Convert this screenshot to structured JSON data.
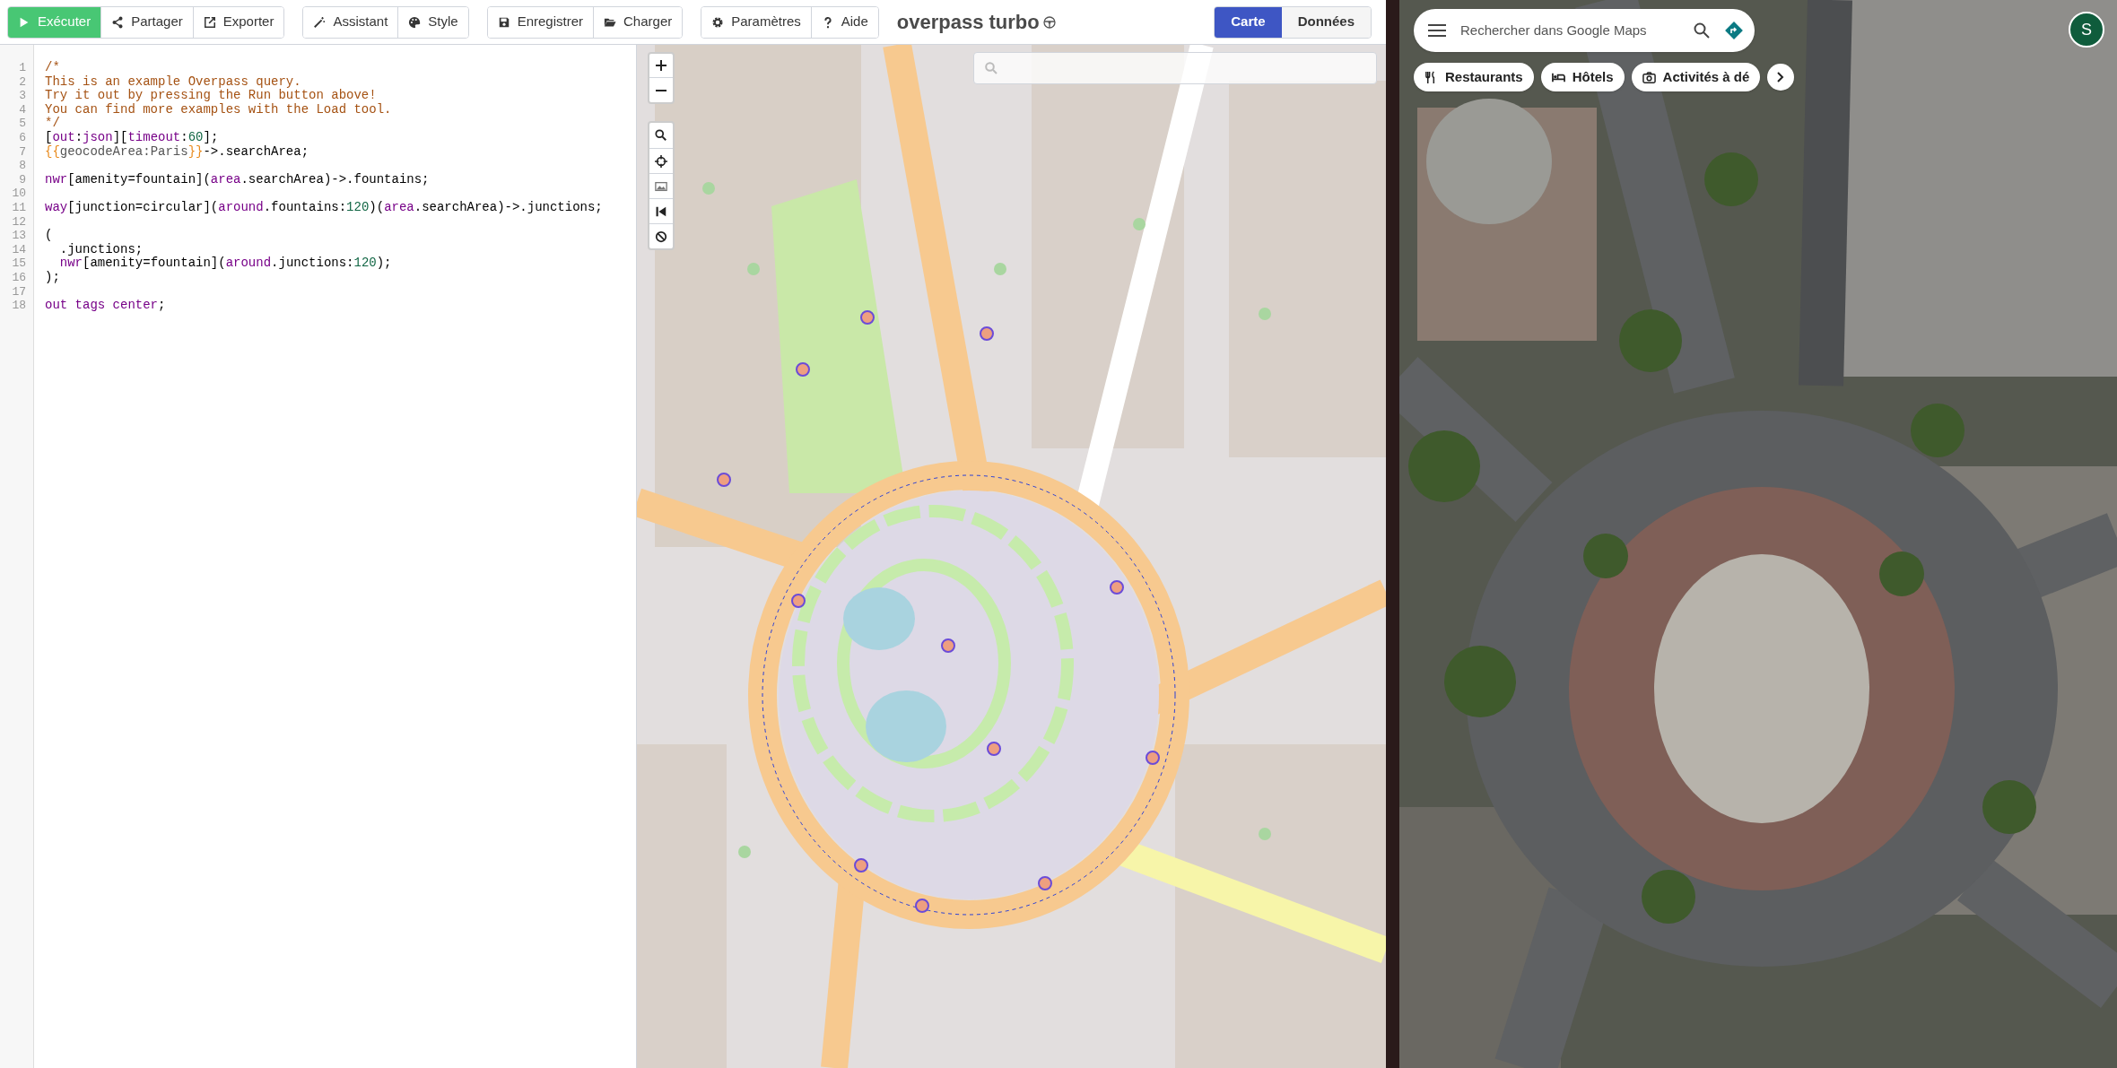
{
  "toolbar": {
    "groups": [
      [
        {
          "label": "Exécuter",
          "kind": "run"
        },
        {
          "label": "Partager",
          "kind": "normal"
        },
        {
          "label": "Exporter",
          "kind": "normal"
        }
      ],
      [
        {
          "label": "Assistant",
          "kind": "normal"
        },
        {
          "label": "Style",
          "kind": "normal"
        }
      ],
      [
        {
          "label": "Enregistrer",
          "kind": "normal"
        },
        {
          "label": "Charger",
          "kind": "normal"
        }
      ],
      [
        {
          "label": "Paramètres",
          "kind": "normal"
        },
        {
          "label": "Aide",
          "kind": "normal"
        }
      ]
    ],
    "app_title": "overpass turbo",
    "view_tabs": [
      {
        "label": "Carte",
        "selected": true
      },
      {
        "label": "Données",
        "selected": false
      }
    ]
  },
  "editor": {
    "lines": [
      {
        "number": "1",
        "tokens": [
          {
            "kind": "comment",
            "text": "/*"
          }
        ]
      },
      {
        "number": "2",
        "tokens": [
          {
            "kind": "comment",
            "text": "This is an example Overpass query."
          }
        ]
      },
      {
        "number": "3",
        "tokens": [
          {
            "kind": "comment",
            "text": "Try it out by pressing the Run button above!"
          }
        ]
      },
      {
        "number": "4",
        "tokens": [
          {
            "kind": "comment",
            "text": "You can find more examples with the Load tool."
          }
        ]
      },
      {
        "number": "5",
        "tokens": [
          {
            "kind": "comment",
            "text": "*/"
          }
        ]
      },
      {
        "number": "6",
        "tokens": [
          {
            "kind": "plain",
            "text": "["
          },
          {
            "kind": "keyword",
            "text": "out"
          },
          {
            "kind": "plain",
            "text": ":"
          },
          {
            "kind": "keyword",
            "text": "json"
          },
          {
            "kind": "plain",
            "text": "]["
          },
          {
            "kind": "keyword",
            "text": "timeout"
          },
          {
            "kind": "plain",
            "text": ":"
          },
          {
            "kind": "number",
            "text": "60"
          },
          {
            "kind": "plain",
            "text": "];"
          }
        ]
      },
      {
        "number": "7",
        "tokens": [
          {
            "kind": "template",
            "text": "{{"
          },
          {
            "kind": "template_body",
            "text": "geocodeArea:Paris"
          },
          {
            "kind": "template",
            "text": "}}"
          },
          {
            "kind": "plain",
            "text": "->.searchArea;"
          }
        ]
      },
      {
        "number": "8"
      },
      {
        "number": "9",
        "tokens": [
          {
            "kind": "keyword",
            "text": "nwr"
          },
          {
            "kind": "plain",
            "text": "[amenity=fountain]("
          },
          {
            "kind": "keyword",
            "text": "area"
          },
          {
            "kind": "plain",
            "text": ".searchArea)->.fountains;"
          }
        ]
      },
      {
        "number": "10"
      },
      {
        "number": "11",
        "tokens": [
          {
            "kind": "keyword",
            "text": "way"
          },
          {
            "kind": "plain",
            "text": "[junction=circular]("
          },
          {
            "kind": "keyword",
            "text": "around"
          },
          {
            "kind": "plain",
            "text": ".fountains:"
          },
          {
            "kind": "number",
            "text": "120"
          },
          {
            "kind": "plain",
            "text": ")("
          },
          {
            "kind": "keyword",
            "text": "area"
          },
          {
            "kind": "plain",
            "text": ".searchArea)->.junctions;"
          }
        ]
      },
      {
        "number": "12"
      },
      {
        "number": "13",
        "tokens": [
          {
            "kind": "plain",
            "text": "("
          }
        ]
      },
      {
        "number": "14",
        "tokens": [
          {
            "kind": "plain",
            "text": "  .junctions;"
          }
        ]
      },
      {
        "number": "15",
        "tokens": [
          {
            "kind": "keyword",
            "text": "  nwr"
          },
          {
            "kind": "plain",
            "text": "[amenity=fountain]("
          },
          {
            "kind": "keyword",
            "text": "around"
          },
          {
            "kind": "plain",
            "text": ".junctions:"
          },
          {
            "kind": "number",
            "text": "120"
          },
          {
            "kind": "plain",
            "text": ");"
          }
        ]
      },
      {
        "number": "16",
        "tokens": [
          {
            "kind": "plain",
            "text": ");"
          }
        ]
      },
      {
        "number": "17"
      },
      {
        "number": "18",
        "tokens": [
          {
            "kind": "keyword",
            "text": "out tags center"
          },
          {
            "kind": "plain",
            "text": ";"
          }
        ]
      }
    ]
  },
  "google_maps": {
    "search_placeholder": "Rechercher dans Google Maps",
    "chips": [
      "Restaurants",
      "Hôtels",
      "Activités à dé"
    ],
    "avatar": "S"
  }
}
